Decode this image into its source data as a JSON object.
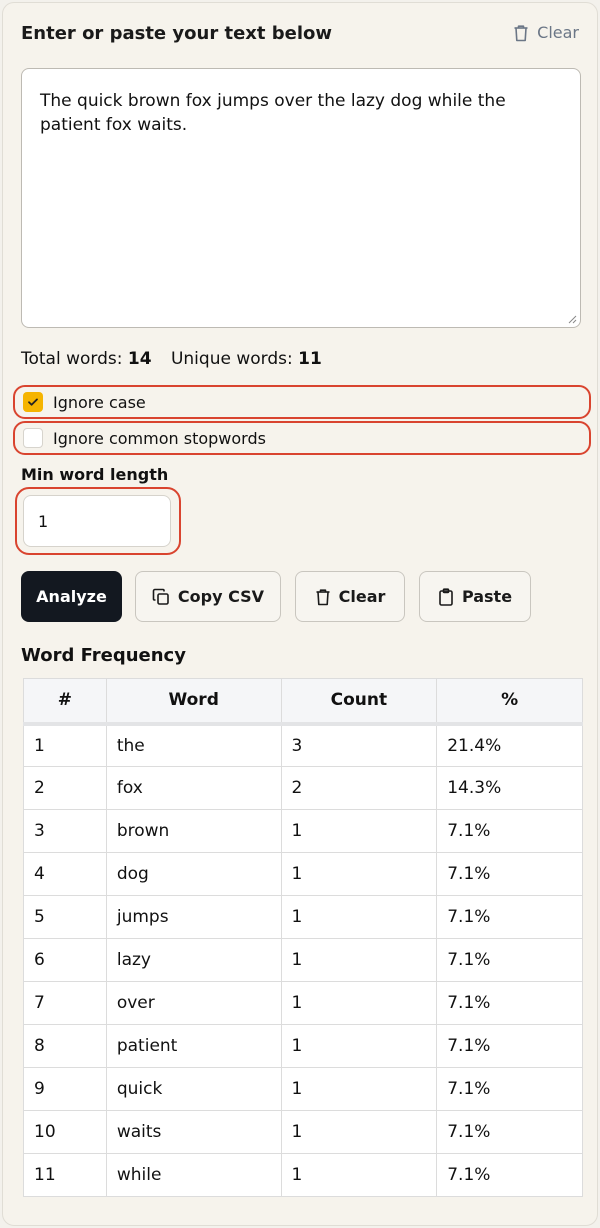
{
  "header": {
    "title": "Enter or paste your text below",
    "clear_label": "Clear"
  },
  "input": {
    "text": "The quick brown fox jumps over the lazy dog while the patient fox waits."
  },
  "stats": {
    "total_label": "Total words:",
    "total_value": "14",
    "unique_label": "Unique words:",
    "unique_value": "11"
  },
  "options": {
    "ignore_case": {
      "label": "Ignore case",
      "checked": true
    },
    "ignore_stopwords": {
      "label": "Ignore common stopwords",
      "checked": false
    }
  },
  "min_length": {
    "label": "Min word length",
    "value": "1"
  },
  "buttons": {
    "analyze": "Analyze",
    "copy_csv": "Copy CSV",
    "clear": "Clear",
    "paste": "Paste"
  },
  "frequency": {
    "title": "Word Frequency",
    "columns": [
      "#",
      "Word",
      "Count",
      "%"
    ],
    "rows": [
      [
        "1",
        "the",
        "3",
        "21.4%"
      ],
      [
        "2",
        "fox",
        "2",
        "14.3%"
      ],
      [
        "3",
        "brown",
        "1",
        "7.1%"
      ],
      [
        "4",
        "dog",
        "1",
        "7.1%"
      ],
      [
        "5",
        "jumps",
        "1",
        "7.1%"
      ],
      [
        "6",
        "lazy",
        "1",
        "7.1%"
      ],
      [
        "7",
        "over",
        "1",
        "7.1%"
      ],
      [
        "8",
        "patient",
        "1",
        "7.1%"
      ],
      [
        "9",
        "quick",
        "1",
        "7.1%"
      ],
      [
        "10",
        "waits",
        "1",
        "7.1%"
      ],
      [
        "11",
        "while",
        "1",
        "7.1%"
      ]
    ]
  },
  "colors": {
    "accent": "#f5b400",
    "highlight": "#d9442f",
    "primary_button": "#131820"
  }
}
